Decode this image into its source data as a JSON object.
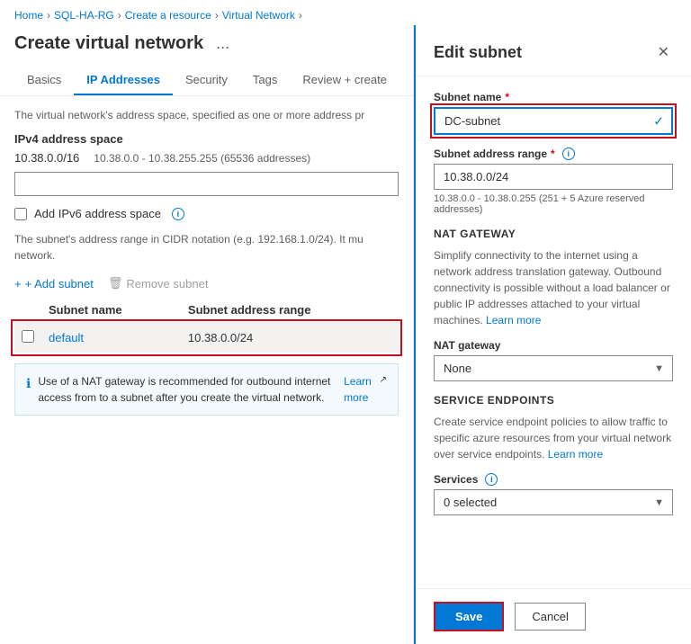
{
  "breadcrumb": {
    "items": [
      "Home",
      "SQL-HA-RG",
      "Create a resource",
      "Virtual Network"
    ],
    "separators": [
      "›",
      "›",
      "›",
      "›"
    ]
  },
  "page": {
    "title": "Create virtual network",
    "ellipsis_label": "..."
  },
  "tabs": [
    {
      "label": "Basics",
      "active": false
    },
    {
      "label": "IP Addresses",
      "active": true
    },
    {
      "label": "Security",
      "active": false
    },
    {
      "label": "Tags",
      "active": false
    },
    {
      "label": "Review + create",
      "active": false
    }
  ],
  "left": {
    "address_space_desc": "The virtual network's address space, specified as one or more address pr",
    "ipv4_section_label": "IPv4 address space",
    "ipv4_tag": "10.38.0.0/16",
    "ipv4_range": "10.38.0.0 - 10.38.255.255 (65536 addresses)",
    "ipv6_checkbox_label": "Add IPv6 address space",
    "cidr_desc": "The subnet's address range in CIDR notation (e.g. 192.168.1.0/24). It mu network.",
    "add_subnet_label": "+ Add subnet",
    "remove_subnet_label": "Remove subnet",
    "remove_subnet_icon": "🗑",
    "subnet_table": {
      "col_checkbox": "",
      "col_name": "Subnet name",
      "col_range": "Subnet address range",
      "rows": [
        {
          "name": "default",
          "range": "10.38.0.0/24",
          "selected": true
        }
      ]
    },
    "info_box_text": "Use of a NAT gateway is recommended for outbound internet access from to a subnet after you create the virtual network.",
    "learn_more": "Learn more"
  },
  "right": {
    "panel_title": "Edit subnet",
    "close_icon": "✕",
    "subnet_name_label": "Subnet name",
    "subnet_name_value": "DC-subnet",
    "subnet_name_check": "✓",
    "subnet_address_range_label": "Subnet address range",
    "subnet_address_range_value": "10.38.0.0/24",
    "subnet_range_hint": "10.38.0.0 - 10.38.0.255 (251 + 5 Azure reserved addresses)",
    "nat_gateway_section": "NAT GATEWAY",
    "nat_gateway_desc": "Simplify connectivity to the internet using a network address translation gateway. Outbound connectivity is possible without a load balancer or public IP addresses attached to your virtual machines.",
    "learn_more_nat": "Learn more",
    "nat_gateway_label": "NAT gateway",
    "nat_gateway_value": "None",
    "nat_gateway_options": [
      "None"
    ],
    "service_endpoints_section": "SERVICE ENDPOINTS",
    "service_endpoints_desc": "Create service endpoint policies to allow traffic to specific azure resources from your virtual network over service endpoints.",
    "learn_more_se": "Learn more",
    "services_label": "Services",
    "services_value": "0 selected",
    "services_options": [
      "0 selected"
    ],
    "save_label": "Save",
    "cancel_label": "Cancel"
  }
}
